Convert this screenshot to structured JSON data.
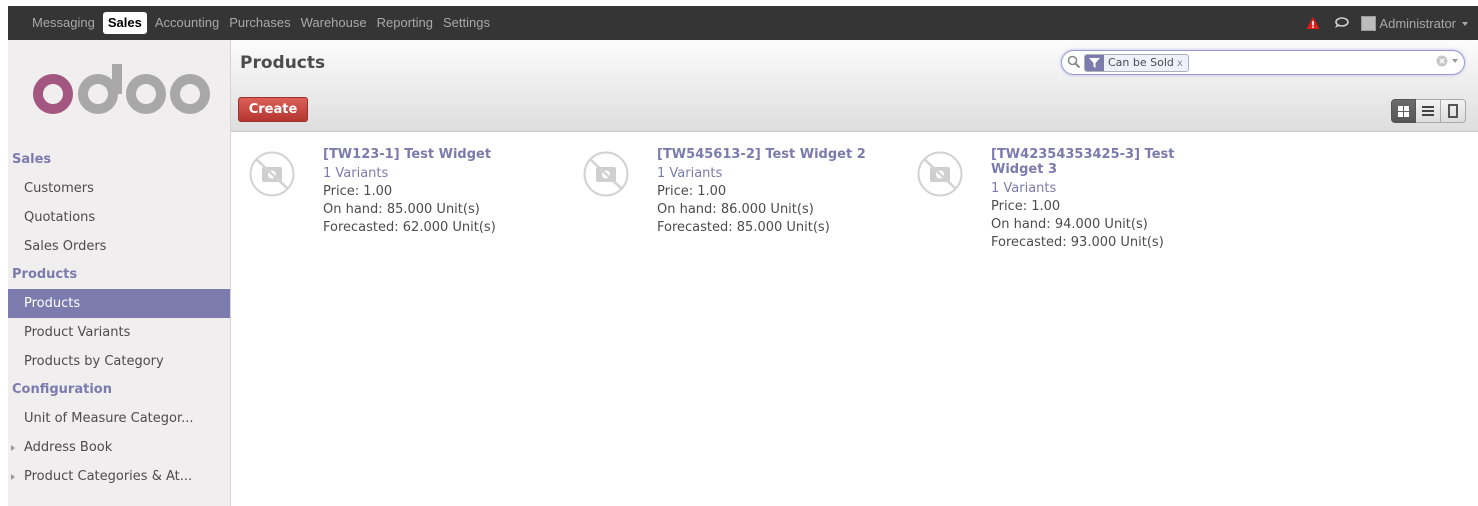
{
  "topbar": {
    "menus": [
      "Messaging",
      "Sales",
      "Accounting",
      "Purchases",
      "Warehouse",
      "Reporting",
      "Settings"
    ],
    "active_menu": "Sales",
    "user": "Administrator"
  },
  "logo_text": "odoo",
  "sidebar": {
    "sections": [
      {
        "title": "Sales",
        "items": [
          {
            "label": "Customers",
            "active": false,
            "expandable": false
          },
          {
            "label": "Quotations",
            "active": false,
            "expandable": false
          },
          {
            "label": "Sales Orders",
            "active": false,
            "expandable": false
          }
        ]
      },
      {
        "title": "Products",
        "items": [
          {
            "label": "Products",
            "active": true,
            "expandable": false
          },
          {
            "label": "Product Variants",
            "active": false,
            "expandable": false
          },
          {
            "label": "Products by Category",
            "active": false,
            "expandable": false
          }
        ]
      },
      {
        "title": "Configuration",
        "items": [
          {
            "label": "Unit of Measure Categor...",
            "active": false,
            "expandable": false
          },
          {
            "label": "Address Book",
            "active": false,
            "expandable": true
          },
          {
            "label": "Product Categories & At...",
            "active": false,
            "expandable": true
          }
        ]
      }
    ]
  },
  "control_panel": {
    "title": "Products",
    "create_label": "Create",
    "search": {
      "facet_value": "Can be Sold",
      "facet_close": "x",
      "query": ""
    }
  },
  "products": [
    {
      "name": "[TW123-1] Test Widget",
      "variants": "1 Variants",
      "price": "Price: 1.00",
      "on_hand": "On hand: 85.000 Unit(s)",
      "forecasted": "Forecasted: 62.000 Unit(s)"
    },
    {
      "name": "[TW545613-2] Test Widget 2",
      "variants": "1 Variants",
      "price": "Price: 1.00",
      "on_hand": "On hand: 86.000 Unit(s)",
      "forecasted": "Forecasted: 85.000 Unit(s)"
    },
    {
      "name": "[TW42354353425-3] Test Widget 3",
      "variants": "1 Variants",
      "price": "Price: 1.00",
      "on_hand": "On hand: 94.000 Unit(s)",
      "forecasted": "Forecasted: 93.000 Unit(s)"
    }
  ],
  "colors": {
    "topbar": "#353535",
    "accent": "#7c7bad",
    "create_button": "#c5403a",
    "warning": "#e21b1b"
  },
  "icons": {
    "warning": "warning-icon",
    "chat": "chat-icon",
    "search": "search-icon",
    "filter": "filter-icon",
    "clear": "clear-search-icon",
    "view_kanban": "kanban-view-icon",
    "view_list": "list-view-icon",
    "view_form": "form-view-icon",
    "product_placeholder": "camera-placeholder-icon"
  }
}
